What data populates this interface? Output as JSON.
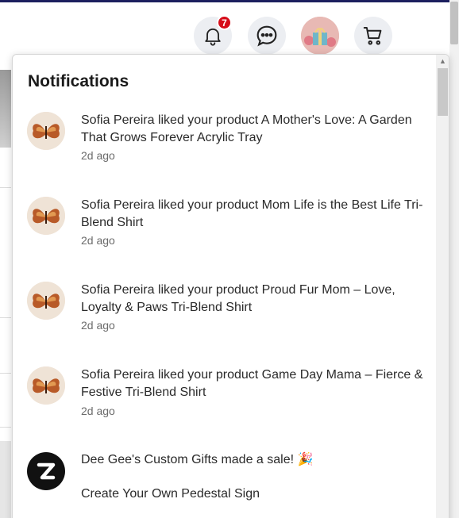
{
  "header": {
    "notifications_count": "7",
    "icons": [
      "bell-icon",
      "chat-icon",
      "avatar",
      "cart-icon"
    ]
  },
  "panel": {
    "title": "Notifications",
    "items": [
      {
        "text": "Sofia Pereira liked your product A Mother's Love: A Garden That Grows Forever Acrylic Tray",
        "time": "2d ago",
        "avatar": "butterfly-avatar"
      },
      {
        "text": "Sofia Pereira liked your product Mom Life is the Best Life Tri-Blend Shirt",
        "time": "2d ago",
        "avatar": "butterfly-avatar"
      },
      {
        "text": "Sofia Pereira liked your product Proud Fur Mom – Love, Loyalty & Paws Tri-Blend Shirt",
        "time": "2d ago",
        "avatar": "butterfly-avatar"
      },
      {
        "text": "Sofia Pereira liked your product Game Day Mama – Fierce & Festive Tri-Blend Shirt",
        "time": "2d ago",
        "avatar": "butterfly-avatar"
      },
      {
        "text": "Dee Gee's Custom Gifts made a sale! 🎉",
        "subtext": "Create Your Own Pedestal Sign",
        "avatar": "zazzle-logo"
      }
    ]
  },
  "colors": {
    "accent_navy": "#1c1f5e",
    "badge_red": "#d60d1a"
  }
}
